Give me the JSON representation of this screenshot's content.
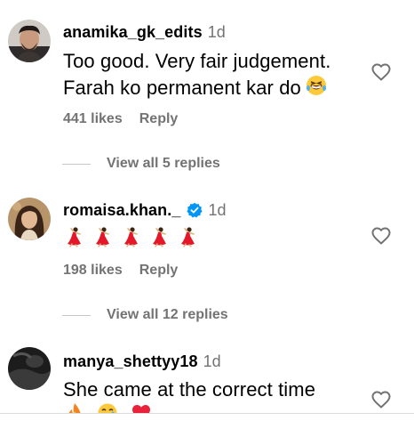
{
  "comments": [
    {
      "username": "anamika_gk_edits",
      "time": "1d",
      "text_line1": "Too good. Very fair judgement.",
      "text_line2": "Farah ko permanent kar do",
      "inline_emoji": "rolling-on-floor-laughing-emoji",
      "likes": "441 likes",
      "reply_label": "Reply",
      "view_replies": "View all 5 replies",
      "liked": false
    },
    {
      "username": "romaisa.khan._",
      "verified": true,
      "time": "1d",
      "emojis": [
        "dancing-woman-emoji",
        "dancing-woman-emoji",
        "dancing-woman-emoji",
        "dancing-woman-emoji",
        "dancing-woman-emoji"
      ],
      "likes": "198 likes",
      "reply_label": "Reply",
      "view_replies": "View all 12 replies",
      "liked": false
    },
    {
      "username": "manya_shettyy18",
      "time": "1d",
      "text_line1": "She came at the correct time",
      "emojis_partial": [
        "fire-emoji",
        "smiling-face-with-tear-emoji",
        "red-heart-emoji"
      ],
      "liked": false
    }
  ],
  "colors": {
    "primary_text": "#000000",
    "secondary_text": "#737373",
    "verified_blue": "#0095f6",
    "divider": "#c7c7c7"
  },
  "icons": {
    "like": "heart-outline-icon",
    "verified": "verified-badge-icon"
  }
}
